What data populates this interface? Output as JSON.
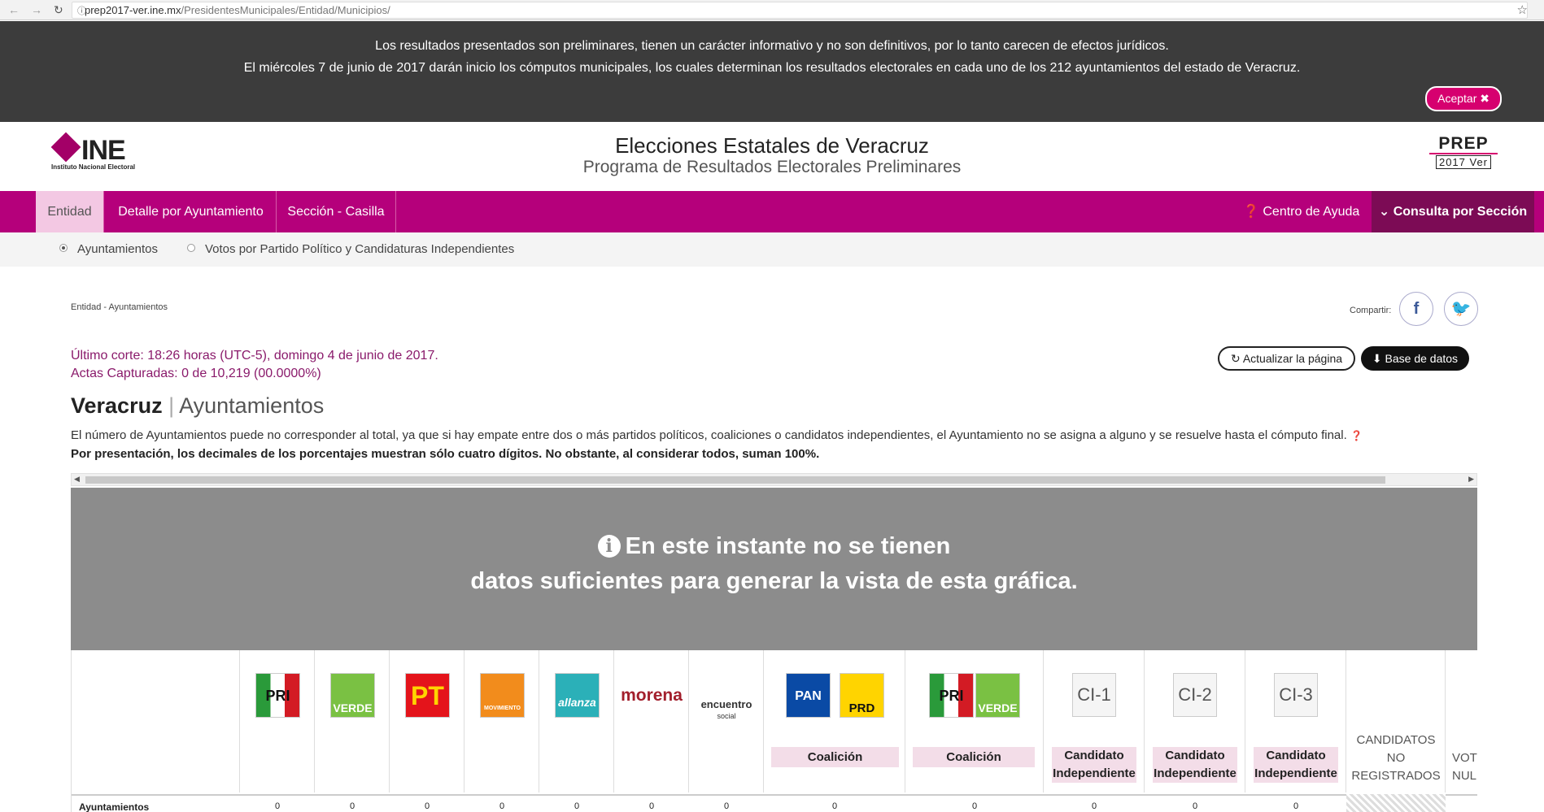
{
  "browser": {
    "url_host": "prep2017-ver.ine.mx",
    "url_path": "/PresidentesMunicipales/Entidad/Municipios/"
  },
  "notice": {
    "line1": "Los resultados presentados son preliminares, tienen un carácter informativo y no son definitivos, por lo tanto carecen de efectos jurídicos.",
    "line2": "El miércoles 7 de junio de 2017 darán inicio los cómputos municipales, los cuales determinan los resultados electorales en cada uno de los 212 ayuntamientos del estado de Veracruz.",
    "accept_label": "Aceptar ✖"
  },
  "header": {
    "logo_word": "INE",
    "logo_sub": "Instituto Nacional Electoral",
    "title": "Elecciones Estatales de Veracruz",
    "subtitle": "Programa de Resultados Electorales Preliminares",
    "prep_word": "PREP",
    "prep_sub": "2017 Ver"
  },
  "nav": {
    "tabs": [
      "Entidad",
      "Detalle por Ayuntamiento",
      "Sección - Casilla"
    ],
    "help": "Centro de Ayuda",
    "consulta": "Consulta por Sección"
  },
  "subopts": {
    "opt1": "Ayuntamientos",
    "opt2": "Votos por Partido Político y Candidaturas Independientes"
  },
  "content": {
    "breadcrumb": "Entidad - Ayuntamientos",
    "share_label": "Compartir:",
    "corte": "Último corte: 18:26 horas (UTC-5), domingo 4 de junio de 2017.",
    "actas": "Actas Capturadas: 0 de 10,219 (00.0000%)",
    "btn_actualizar": "Actualizar la página",
    "btn_base": "Base de datos",
    "title_bold": "Veracruz",
    "title_sep": "|",
    "title_light": "Ayuntamientos",
    "desc1": "El número de Ayuntamientos puede no corresponder al total, ya que si hay empate entre dos o más partidos políticos, coaliciones o candidatos independientes, el Ayuntamiento no se asigna a alguno y se resuelve hasta el cómputo final.",
    "desc2": "Por presentación, los decimales de los porcentajes muestran sólo cuatro dígitos. No obstante, al considerar todos, suman 100%.",
    "nodata_line1": "En este instante no se tienen",
    "nodata_line2": "datos suficientes para generar la vista de esta gráfica."
  },
  "table": {
    "row_label": "Ayuntamientos",
    "parties": {
      "pri": "PRI",
      "verde": "VERDE",
      "pt": "PT",
      "mc": "MOVIMIENTO CIUDADANO",
      "na": "allanza",
      "morena": "morena",
      "es1": "encuentro",
      "es2": "social",
      "pan": "PAN",
      "prd": "PRD"
    },
    "coalicion": "Coalición",
    "ci1": "CI-1",
    "ci2": "CI-2",
    "ci3": "CI-3",
    "cand_line1": "Candidato",
    "cand_line2": "Independiente",
    "noreg_l1": "CANDIDATOS",
    "noreg_l2": "NO",
    "noreg_l3": "REGISTRADOS",
    "nulos_l1": "VOT",
    "nulos_l2": "NUL",
    "values": [
      "0",
      "0",
      "0",
      "0",
      "0",
      "0",
      "0",
      "0",
      "0",
      "0",
      "0",
      "0"
    ]
  }
}
